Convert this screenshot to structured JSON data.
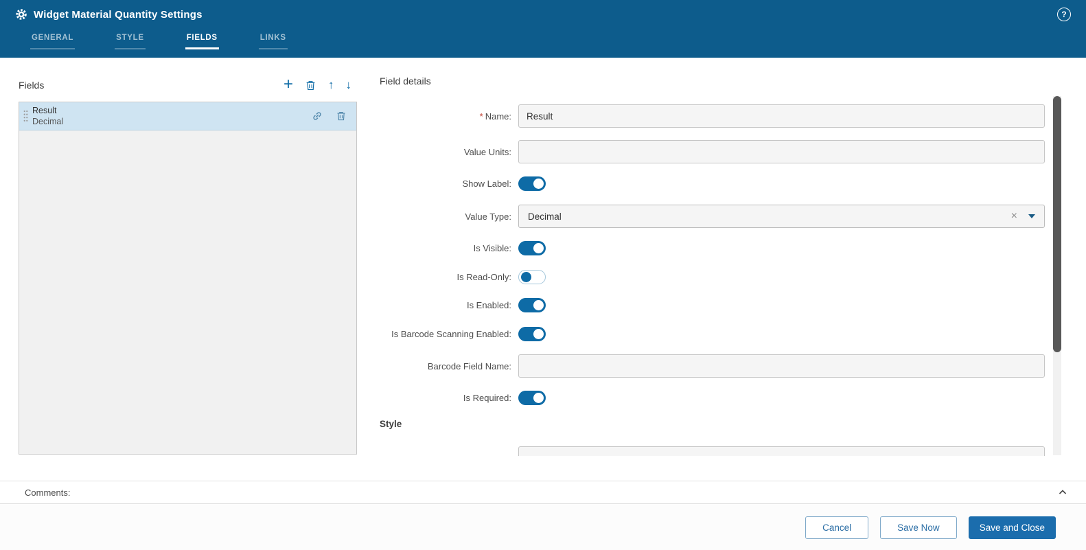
{
  "colors": {
    "header_bg": "#0d5c8c",
    "accent": "#0e6ba6",
    "primary_button_bg": "#1b6dad",
    "selected_row_bg": "#cfe4f2",
    "required_mark": "#c0392b"
  },
  "icons": {
    "add": "+",
    "move_up": "↑",
    "move_down": "↓",
    "help": "?",
    "clear": "×"
  },
  "header": {
    "title": "Widget Material Quantity Settings",
    "tabs": [
      {
        "id": "general",
        "label": "GENERAL",
        "active": false
      },
      {
        "id": "style",
        "label": "STYLE",
        "active": false
      },
      {
        "id": "fields",
        "label": "FIELDS",
        "active": true
      },
      {
        "id": "links",
        "label": "LINKS",
        "active": false
      }
    ]
  },
  "fields_panel": {
    "title": "Fields",
    "selected_item": {
      "name": "Result",
      "type": "Decimal"
    }
  },
  "details": {
    "title": "Field details",
    "required_mark": "*",
    "name": {
      "label": "Name:",
      "value": "Result"
    },
    "value_units": {
      "label": "Value Units:",
      "value": ""
    },
    "show_label": {
      "label": "Show Label:",
      "on": true
    },
    "value_type": {
      "label": "Value Type:",
      "value": "Decimal"
    },
    "is_visible": {
      "label": "Is Visible:",
      "on": true
    },
    "is_read_only": {
      "label": "Is Read-Only:",
      "on": false
    },
    "is_enabled": {
      "label": "Is Enabled:",
      "on": true
    },
    "is_barcode_scanning_enabled": {
      "label": "Is Barcode Scanning Enabled:",
      "on": true
    },
    "barcode_field_name": {
      "label": "Barcode Field Name:",
      "value": ""
    },
    "is_required": {
      "label": "Is Required:",
      "on": true
    },
    "style_heading": "Style"
  },
  "comments": {
    "label": "Comments:"
  },
  "footer": {
    "cancel": "Cancel",
    "save_now": "Save Now",
    "save_and_close": "Save and Close"
  }
}
